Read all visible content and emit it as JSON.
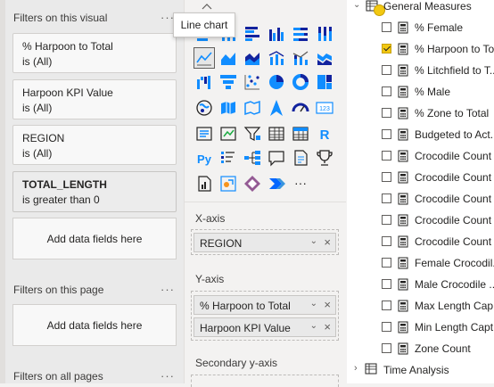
{
  "filters": {
    "visual_title": "Filters on this visual",
    "page_title": "Filters on this page",
    "all_title": "Filters on all pages",
    "more": "···",
    "cards": [
      {
        "title": "% Harpoon to Total",
        "sub": "is (All)"
      },
      {
        "title": "Harpoon KPI Value",
        "sub": "is (All)"
      },
      {
        "title": "REGION",
        "sub": "is (All)"
      },
      {
        "title": "TOTAL_LENGTH",
        "sub": "is greater than 0"
      }
    ],
    "add_fields": "Add data fields here"
  },
  "viz": {
    "tooltip": "Line chart",
    "more_icon": "···",
    "xaxis_label": "X-axis",
    "yaxis_label": "Y-axis",
    "secondary_label": "Secondary y-axis",
    "xaxis_fields": [
      "REGION"
    ],
    "yaxis_fields": [
      "% Harpoon to Total",
      "Harpoon KPI Value"
    ],
    "icons": [
      "stacked-bar-chart-icon",
      "stacked-column-chart-icon",
      "clustered-bar-chart-icon",
      "clustered-column-chart-icon",
      "100-stacked-bar-chart-icon",
      "100-stacked-column-chart-icon",
      "line-chart-icon",
      "area-chart-icon",
      "stacked-area-chart-icon",
      "line-clustered-column-icon",
      "line-stacked-column-icon",
      "ribbon-chart-icon",
      "waterfall-chart-icon",
      "funnel-icon",
      "scatter-chart-icon",
      "pie-chart-icon",
      "donut-chart-icon",
      "treemap-icon",
      "map-icon",
      "filled-map-icon",
      "shape-map-icon",
      "azure-map-icon",
      "gauge-icon",
      "card-icon",
      "multi-row-card-icon",
      "kpi-icon",
      "slicer-icon",
      "table-icon",
      "matrix-icon",
      "r-visual-icon",
      "python-visual-icon",
      "key-influencers-icon",
      "decomposition-tree-icon",
      "qa-icon",
      "smart-narrative-icon",
      "metrics-icon",
      "paginated-report-icon",
      "arcgis-icon",
      "power-apps-icon",
      "power-automate-icon",
      "more-visuals-icon"
    ]
  },
  "fields": {
    "table_name": "General Measures",
    "next_table": "Time Analysis",
    "items": [
      {
        "label": "% Female",
        "checked": false
      },
      {
        "label": "% Harpoon to To",
        "checked": true
      },
      {
        "label": "% Litchfield to T...",
        "checked": false
      },
      {
        "label": "% Male",
        "checked": false
      },
      {
        "label": "% Zone to Total",
        "checked": false
      },
      {
        "label": "Budgeted to Act...",
        "checked": false
      },
      {
        "label": "Crocodile Count",
        "checked": false
      },
      {
        "label": "Crocodile Count",
        "checked": false
      },
      {
        "label": "Crocodile Count",
        "checked": false
      },
      {
        "label": "Crocodile Count",
        "checked": false
      },
      {
        "label": "Crocodile Count",
        "checked": false
      },
      {
        "label": "Female Crocodil...",
        "checked": false
      },
      {
        "label": "Male Crocodile ...",
        "checked": false
      },
      {
        "label": "Max Length Cap...",
        "checked": false
      },
      {
        "label": "Min Length Capt",
        "checked": false
      },
      {
        "label": "Zone Count",
        "checked": false
      }
    ]
  },
  "colors": {
    "accent": "#f2c811",
    "viz_blue": "#118dff",
    "viz_teal": "#12239e"
  }
}
